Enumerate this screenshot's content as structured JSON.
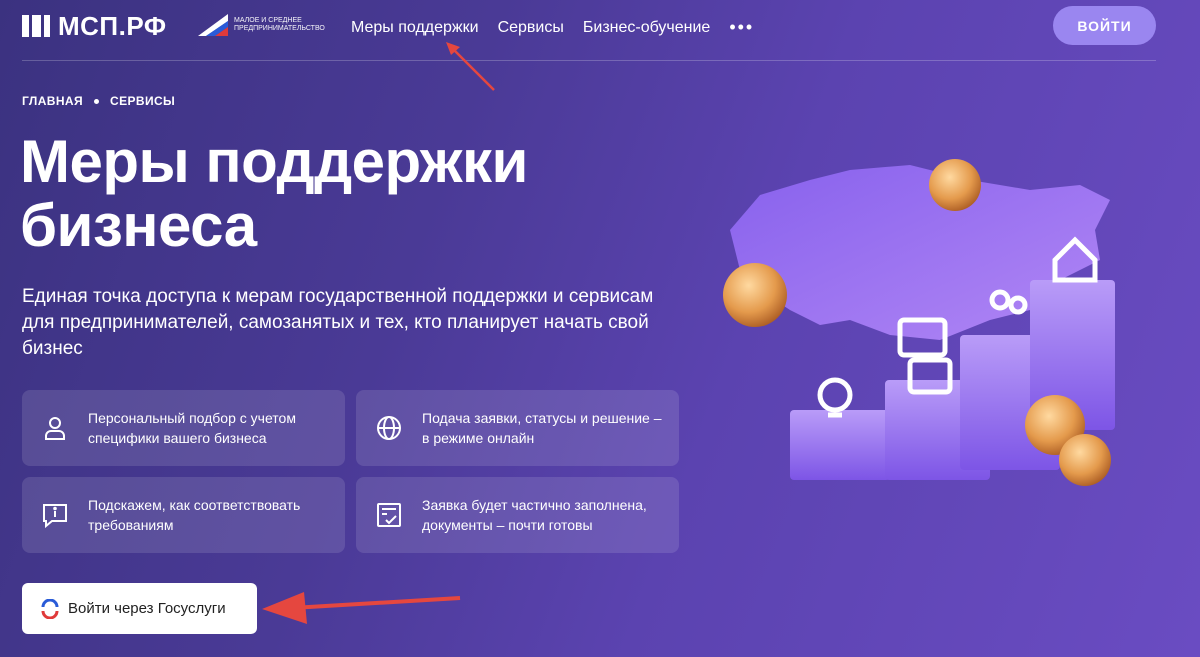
{
  "header": {
    "logo_text": "МСП.РФ",
    "partner_text": "Малое и среднее предпринимательство",
    "nav": [
      "Меры поддержки",
      "Сервисы",
      "Бизнес-обучение"
    ],
    "more": "•••",
    "login_label": "ВОЙТИ"
  },
  "breadcrumb": [
    "ГЛАВНАЯ",
    "СЕРВИСЫ"
  ],
  "hero": {
    "title": "Меры поддержки бизнеса",
    "subtitle": "Единая точка доступа к мерам государственной поддержки и сервисам для предпринимателей, самозанятых и тех, кто планирует начать свой бизнес"
  },
  "cards": [
    {
      "icon": "person-icon",
      "text": "Персональный подбор с учетом специфики вашего бизнеса"
    },
    {
      "icon": "globe-icon",
      "text": "Подача заявки, статусы и решение – в режиме онлайн"
    },
    {
      "icon": "info-chat-icon",
      "text": "Подскажем, как соответствовать требованиям"
    },
    {
      "icon": "form-check-icon",
      "text": "Заявка будет частично заполнена, документы – почти готовы"
    }
  ],
  "gosuslugi": {
    "label": "Войти через Госуслуги",
    "icon": "gosuslugi-icon"
  },
  "colors": {
    "accent": "#9a86f0",
    "arrow": "#e5473f"
  }
}
